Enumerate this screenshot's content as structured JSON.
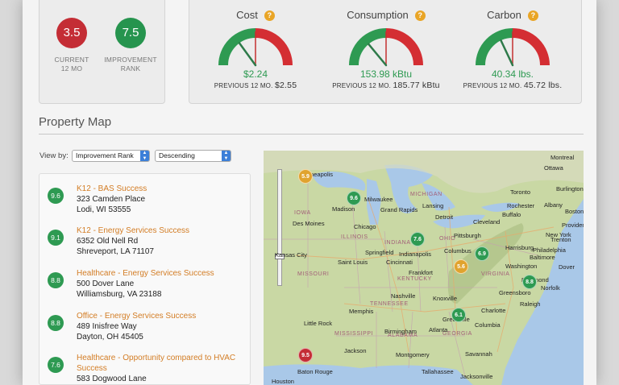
{
  "scores": {
    "current": {
      "value": "3.5",
      "label": "CURRENT 12 MO",
      "color": "#c42d35"
    },
    "improvement": {
      "value": "7.5",
      "label": "IMPROVEMENT RANK",
      "color": "#26944e"
    }
  },
  "gauges": [
    {
      "title": "Cost",
      "help_icon": "?",
      "value": "$2.24",
      "prev_label": "PREVIOUS 12 MO.",
      "prev_value": "$2.55",
      "needle_fraction": 0.3
    },
    {
      "title": "Consumption",
      "help_icon": "?",
      "value": "153.98 kBtu",
      "prev_label": "PREVIOUS 12 MO.",
      "prev_value": "185.77 kBtu",
      "needle_fraction": 0.28
    },
    {
      "title": "Carbon",
      "help_icon": "?",
      "value": "40.34 lbs.",
      "prev_label": "PREVIOUS 12 MO.",
      "prev_value": "45.72 lbs.",
      "needle_fraction": 0.36
    }
  ],
  "property_map": {
    "title": "Property Map",
    "view_by_label": "View by:",
    "sort_field": "Improvement Rank",
    "sort_order": "Descending"
  },
  "properties": [
    {
      "rank": "9.6",
      "name": "K12 - BAS Success",
      "address1": "323 Camden Place",
      "address2": "Lodi, WI 53555"
    },
    {
      "rank": "9.1",
      "name": "K12 - Energy Services Success",
      "address1": "6352 Old Nell Rd",
      "address2": "Shreveport, LA 71107"
    },
    {
      "rank": "8.8",
      "name": "Healthcare - Energy Services Success",
      "address1": "500 Dover Lane",
      "address2": "Williamsburg, VA 23188"
    },
    {
      "rank": "8.8",
      "name": "Office - Energy Services Success",
      "address1": "489 Inisfree Way",
      "address2": "Dayton, OH 45405"
    },
    {
      "rank": "7.6",
      "name": "Healthcare - Opportunity compared to HVAC Success",
      "address1": "583 Dogwood Lane",
      "address2": ""
    }
  ],
  "map": {
    "cities": [
      "Minneapolis",
      "Ottawa",
      "Montreal",
      "Milwaukee",
      "Toronto",
      "Madison",
      "Lansing",
      "Burlington",
      "Albany",
      "Des Moines",
      "Grand Rapids",
      "Rochester",
      "Boston",
      "Chicago",
      "Detroit",
      "Cleveland",
      "Buffalo",
      "Providence",
      "Pittsburgh",
      "Harrisburg",
      "New York",
      "Philadelphia",
      "Kansas City",
      "Columbus",
      "Springfield",
      "Saint Louis",
      "Cincinnati",
      "Indianapolis",
      "Trenton",
      "Baltimore",
      "Washington",
      "Dover",
      "Richmond",
      "Frankfort",
      "Norfolk",
      "Nashville",
      "Greensboro",
      "Knoxville",
      "Raleigh",
      "Memphis",
      "Charlotte",
      "Little Rock",
      "Greenville",
      "Columbia",
      "Birmingham",
      "Atlanta",
      "Jackson",
      "Savannah",
      "Montgomery",
      "Tallahassee",
      "Baton Rouge",
      "Jacksonville",
      "Houston"
    ],
    "states": [
      "IOWA",
      "ILLINOIS",
      "INDIANA",
      "OHIO",
      "MICHIGAN",
      "KENTUCKY",
      "TENNESSEE",
      "MISSISSIPPI",
      "ALABAMA",
      "GEORGIA",
      "MISSOURI",
      "VIRGINIA"
    ],
    "pins": [
      {
        "value": "5.9",
        "color": "o"
      },
      {
        "value": "9.6",
        "color": "g"
      },
      {
        "value": "7.6",
        "color": "g"
      },
      {
        "value": "5.6",
        "color": "o"
      },
      {
        "value": "6.9",
        "color": "g"
      },
      {
        "value": "8.8",
        "color": "g"
      },
      {
        "value": "6.1",
        "color": "g"
      },
      {
        "value": "9.5",
        "color": "r"
      }
    ]
  }
}
